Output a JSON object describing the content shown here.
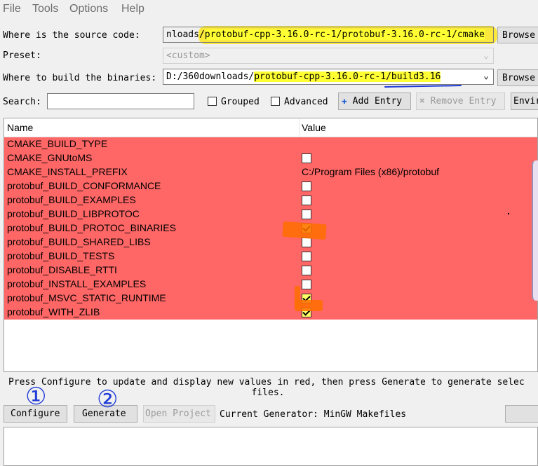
{
  "menu": [
    "File",
    "Tools",
    "Options",
    "Help"
  ],
  "source": {
    "label": "Where is the source code:",
    "prefix": "nloads/",
    "highlighted": "protobuf-cpp-3.16.0-rc-1/protobuf-3.16.0-rc-1/cmake",
    "browse": "Browse"
  },
  "preset": {
    "label": "Preset:",
    "value": "<custom>"
  },
  "build": {
    "label": "Where to build the binaries:",
    "prefix": "D:/360downloads/",
    "highlighted": "protobuf-cpp-3.16.0-rc-1/build3.16",
    "browse": "Browse"
  },
  "search": {
    "label": "Search:",
    "value": "",
    "grouped": "Grouped",
    "advanced": "Advanced",
    "add_entry": "Add Entry",
    "remove_entry": "Remove Entry",
    "environment": "Envir"
  },
  "table": {
    "headers": [
      "Name",
      "Value"
    ],
    "rows": [
      {
        "name": "CMAKE_BUILD_TYPE",
        "value": "",
        "type": "text"
      },
      {
        "name": "CMAKE_GNUtoMS",
        "type": "bool",
        "checked": false
      },
      {
        "name": "CMAKE_INSTALL_PREFIX",
        "value": "C:/Program Files (x86)/protobuf",
        "type": "text"
      },
      {
        "name": "protobuf_BUILD_CONFORMANCE",
        "type": "bool",
        "checked": false
      },
      {
        "name": "protobuf_BUILD_EXAMPLES",
        "type": "bool",
        "checked": false
      },
      {
        "name": "protobuf_BUILD_LIBPROTOC",
        "type": "bool",
        "checked": false
      },
      {
        "name": "protobuf_BUILD_PROTOC_BINARIES",
        "type": "bool",
        "checked": true
      },
      {
        "name": "protobuf_BUILD_SHARED_LIBS",
        "type": "bool",
        "checked": false
      },
      {
        "name": "protobuf_BUILD_TESTS",
        "type": "bool",
        "checked": false
      },
      {
        "name": "protobuf_DISABLE_RTTI",
        "type": "bool",
        "checked": false
      },
      {
        "name": "protobuf_INSTALL_EXAMPLES",
        "type": "bool",
        "checked": false
      },
      {
        "name": "protobuf_MSVC_STATIC_RUNTIME",
        "type": "bool",
        "checked": true
      },
      {
        "name": "protobuf_WITH_ZLIB",
        "type": "bool",
        "checked": true
      }
    ]
  },
  "info": "Press Configure to update and display new values in red, then press Generate to generate selec files.",
  "info_line1": "Press Configure to update and display new values in red, then press Generate to generate selec",
  "info_line2": "files.",
  "actions": {
    "configure": "Configure",
    "generate": "Generate",
    "open_project": "Open Project",
    "generator": "Current Generator: MinGW Makefiles"
  },
  "annotations": [
    "①",
    "②"
  ],
  "colors": {
    "row_red": "#ff6666",
    "highlight_yellow": "#ffff33",
    "mark_orange": "#ff6e00",
    "pen_blue": "#1f3bd8"
  }
}
